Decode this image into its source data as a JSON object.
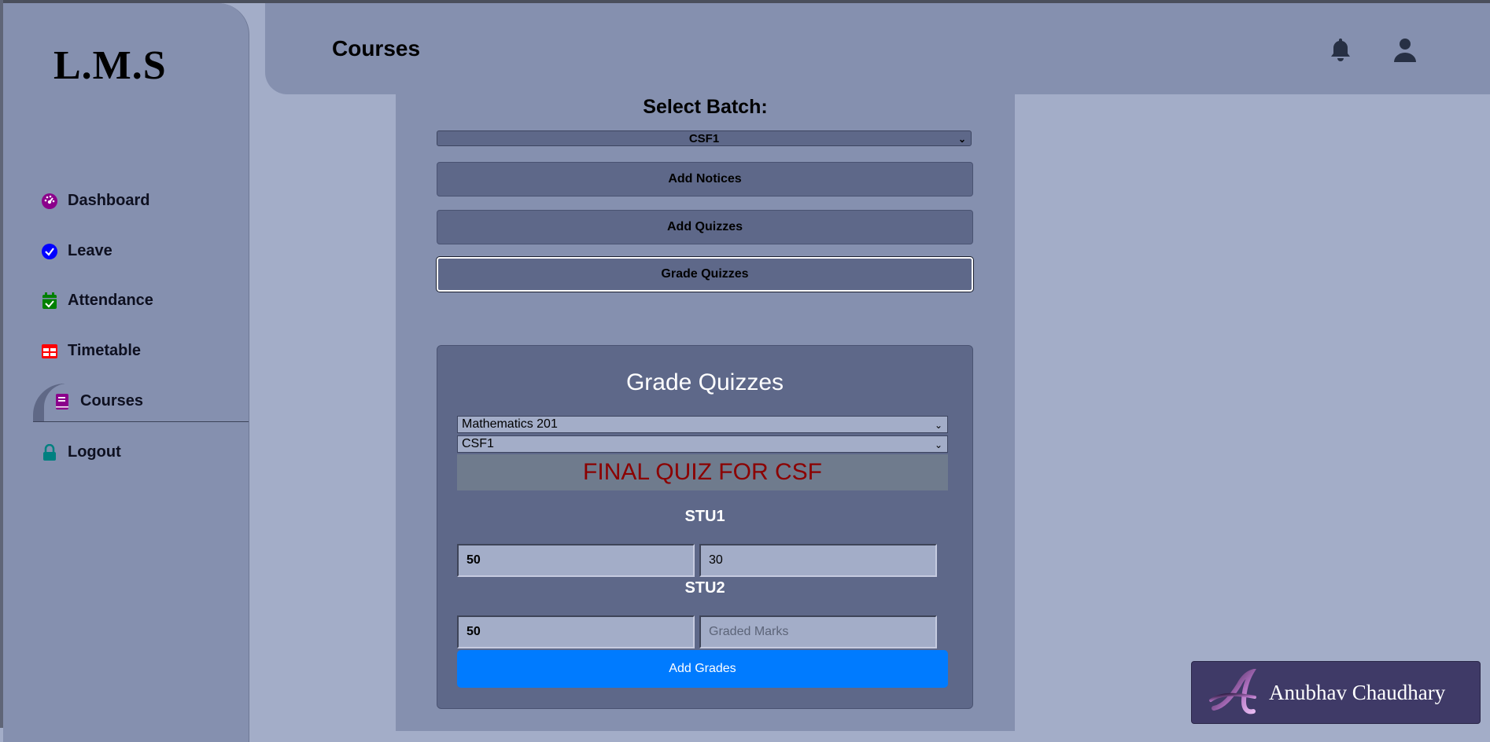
{
  "app": {
    "logo": "L.M.S"
  },
  "sidebar": {
    "items": [
      {
        "label": "Dashboard",
        "icon": "dashboard-gauge-icon",
        "color": "#8b008b"
      },
      {
        "label": "Leave",
        "icon": "check-circle-icon",
        "color": "#0000ff"
      },
      {
        "label": "Attendance",
        "icon": "calendar-check-icon",
        "color": "#008000"
      },
      {
        "label": "Timetable",
        "icon": "table-icon",
        "color": "#ff0000"
      },
      {
        "label": "Courses",
        "icon": "book-icon",
        "color": "#8b008b",
        "active": true
      },
      {
        "label": "Logout",
        "icon": "lock-icon",
        "color": "#008080"
      }
    ]
  },
  "header": {
    "title": "Courses",
    "icons": [
      "bell-icon",
      "user-icon"
    ]
  },
  "main": {
    "select_batch_label": "Select Batch:",
    "batch_value": "CSF1",
    "buttons": {
      "add_notices": "Add Notices",
      "add_quizzes": "Add Quizzes",
      "grade_quizzes": "Grade Quizzes"
    },
    "grade_card": {
      "title": "Grade Quizzes",
      "course_value": "Mathematics 201",
      "batch_value": "CSF1",
      "quiz_title": "FINAL QUIZ FOR CSF",
      "students": [
        {
          "name": "STU1",
          "total_marks": "50",
          "graded_marks": "30",
          "graded_placeholder": "Graded Marks"
        },
        {
          "name": "STU2",
          "total_marks": "50",
          "graded_marks": "",
          "graded_placeholder": "Graded Marks"
        }
      ],
      "submit_label": "Add Grades"
    }
  },
  "watermark": {
    "name": "Anubhav Chaudhary"
  },
  "colors": {
    "background": "#a3adc8",
    "sidebar": "#8590af",
    "card": "#5e6889",
    "primary_button": "#007bff",
    "quiz_title_text": "#8b0000"
  }
}
